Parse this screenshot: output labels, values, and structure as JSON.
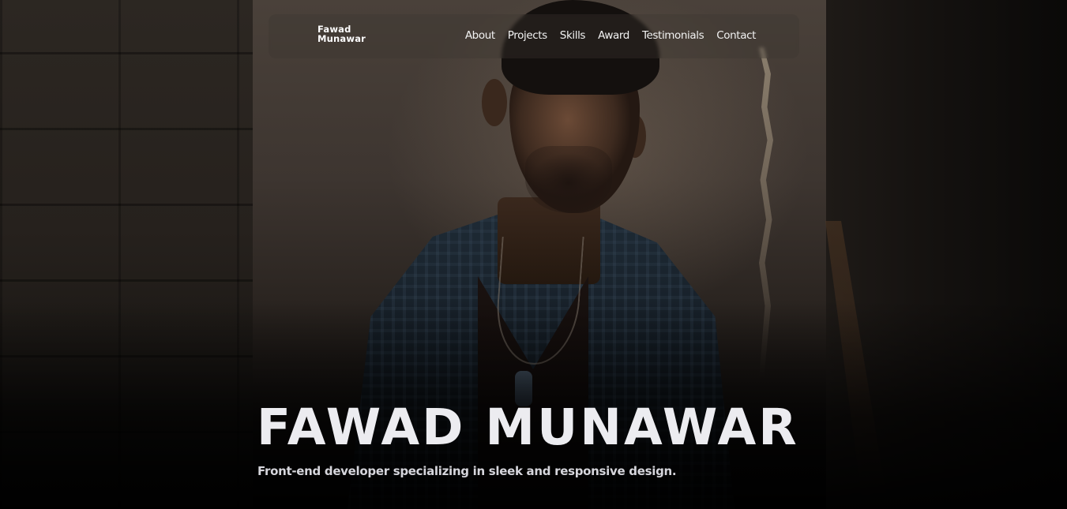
{
  "nav": {
    "logo_line1": "Fawad",
    "logo_line2": "Munawar",
    "links": [
      {
        "label": "About"
      },
      {
        "label": "Projects"
      },
      {
        "label": "Skills"
      },
      {
        "label": "Award"
      },
      {
        "label": "Testimonials"
      },
      {
        "label": "Contact"
      }
    ]
  },
  "hero": {
    "title": "FAWAD MUNAWAR",
    "subtitle": "Front-end developer specializing in sleek and responsive design."
  },
  "colors": {
    "top_border": "#0f1a5c",
    "hero_text": "#ececf0",
    "nav_text": "#f2f2f2"
  }
}
